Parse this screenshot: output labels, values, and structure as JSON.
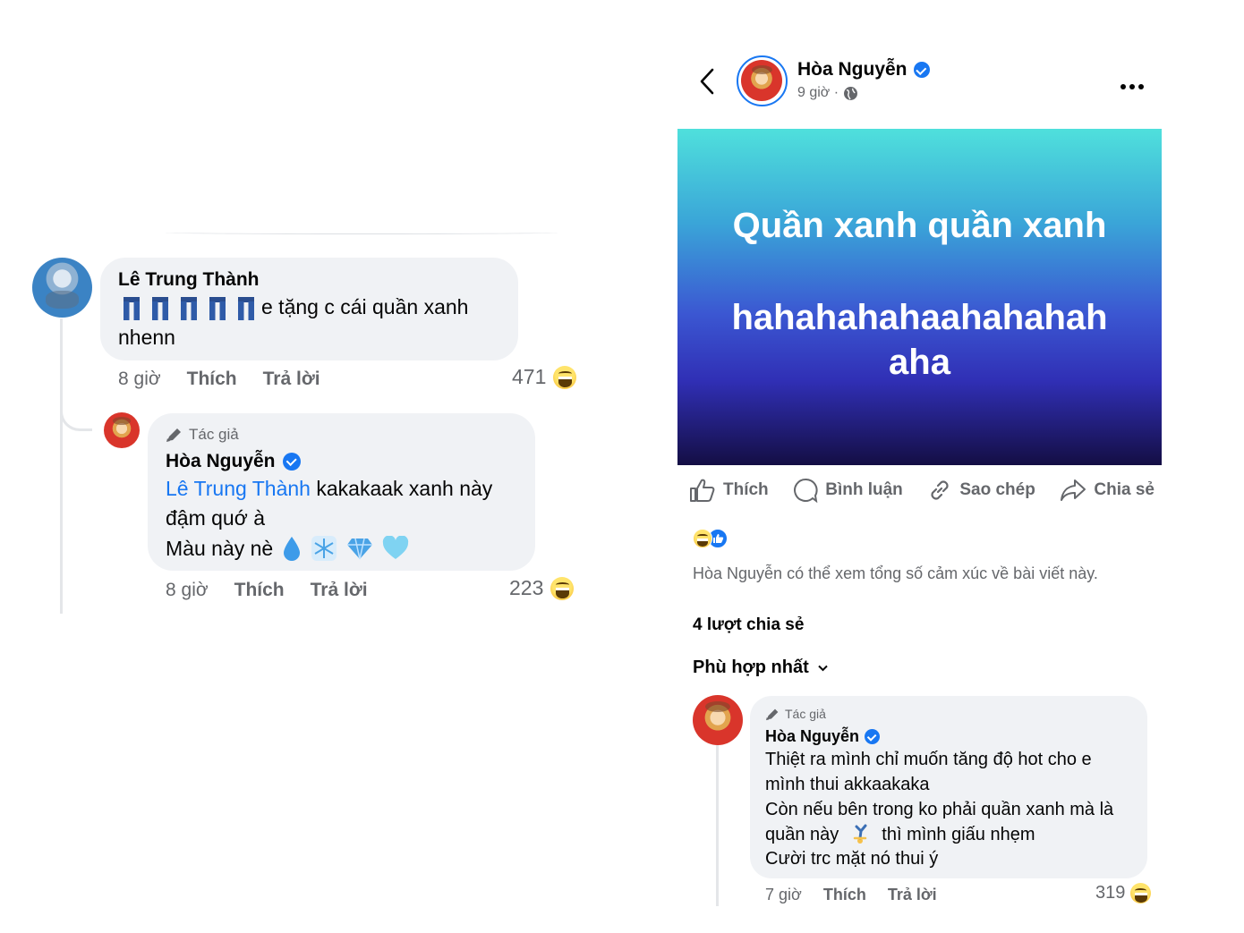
{
  "left": {
    "comment1": {
      "author": "Lê Trung Thành",
      "text_after_emoji": "e tặng c cái quần xanh",
      "text_line2": "nhenn",
      "time": "8 giờ",
      "like": "Thích",
      "reply": "Trả lời",
      "reaction_count": "471"
    },
    "reply1": {
      "badge": "Tác giả",
      "author": "Hòa Nguyễn",
      "mention": "Lê Trung Thành",
      "text_line1_rest": " kakakaak xanh này",
      "text_line2": "đậm quớ à",
      "text_line3": "Màu này nè",
      "time": "8 giờ",
      "like": "Thích",
      "reply": "Trả lời",
      "reaction_count": "223"
    }
  },
  "right": {
    "header": {
      "author": "Hòa Nguyễn",
      "time": "9 giờ ·"
    },
    "post": {
      "line1": "Quần xanh quần xanh",
      "line2": "hahahahahaahahahah aha"
    },
    "actions": {
      "like": "Thích",
      "comment": "Bình luận",
      "copy": "Sao chép",
      "share": "Chia sẻ"
    },
    "reaction_note": "Hòa Nguyễn có thể xem tổng số cảm xúc về bài viết này.",
    "shares": "4 lượt chia sẻ",
    "sort": "Phù hợp nhất",
    "comment": {
      "badge": "Tác giả",
      "author": "Hòa Nguyễn",
      "line1": "Thiệt ra mình chỉ muốn tăng độ hot cho e",
      "line2": "mình thui akkaakaka",
      "line3": "Còn nếu bên trong ko phải quần xanh mà là",
      "line4a": "quần này",
      "line4b": "thì mình giấu nhẹm",
      "line5": "Cười trc mặt nó thui ý",
      "time": "7 giờ",
      "like": "Thích",
      "reply": "Trả lời",
      "reaction_count": "319"
    }
  },
  "colors": {
    "link_blue": "#1877f2",
    "bubble_bg": "#f0f2f5",
    "meta_gray": "#65676b"
  }
}
